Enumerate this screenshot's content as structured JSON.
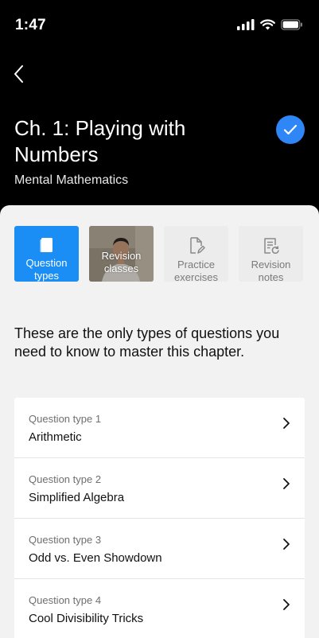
{
  "status": {
    "time": "1:47"
  },
  "header": {
    "title": "Ch. 1: Playing with Numbers",
    "subtitle": "Mental Mathematics",
    "completed": true,
    "accent": "#2f86f6"
  },
  "tiles": [
    {
      "label": "Question types",
      "icon": "book-icon",
      "active": true
    },
    {
      "label": "Revision classes",
      "icon": "video-thumbnail",
      "active": false
    },
    {
      "label": "Practice exercises",
      "icon": "edit-document-icon",
      "active": false
    },
    {
      "label": "Revision notes",
      "icon": "notes-refresh-icon",
      "active": false
    }
  ],
  "intro": "These are the only types of questions you need to know to master this chapter.",
  "questions": [
    {
      "label": "Question type 1",
      "name": "Arithmetic"
    },
    {
      "label": "Question type 2",
      "name": "Simplified Algebra"
    },
    {
      "label": "Question type 3",
      "name": "Odd vs. Even Showdown"
    },
    {
      "label": "Question type 4",
      "name": "Cool Divisibility Tricks"
    }
  ],
  "colors": {
    "active_tile": "#1a8ef5",
    "sheet_bg": "#f2f2f2",
    "header_bg": "#000000"
  }
}
